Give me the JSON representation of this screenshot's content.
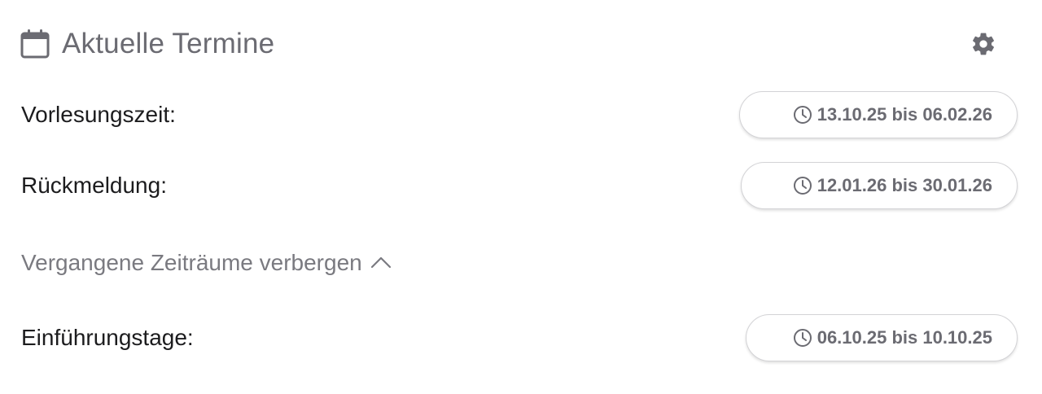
{
  "header": {
    "title": "Aktuelle Termine",
    "icon": "calendar-icon",
    "settings_icon": "gear-icon"
  },
  "rows_current": [
    {
      "label": "Vorlesungszeit:",
      "range": "13.10.25 bis 06.02.26",
      "icon": "clock-icon"
    },
    {
      "label": "Rückmeldung:",
      "range": "12.01.26 bis 30.01.26",
      "icon": "clock-icon"
    }
  ],
  "past_toggle": {
    "label": "Vergangene Zeiträume verbergen",
    "icon": "chevron-up-icon"
  },
  "rows_past": [
    {
      "label": "Einführungstage:",
      "range": "06.10.25 bis 10.10.25",
      "icon": "clock-icon"
    }
  ],
  "colors": {
    "title": "#6b6b72",
    "label": "#1c1c1e",
    "pill_text": "#6b6b72",
    "toggle_text": "#7a7a80"
  }
}
